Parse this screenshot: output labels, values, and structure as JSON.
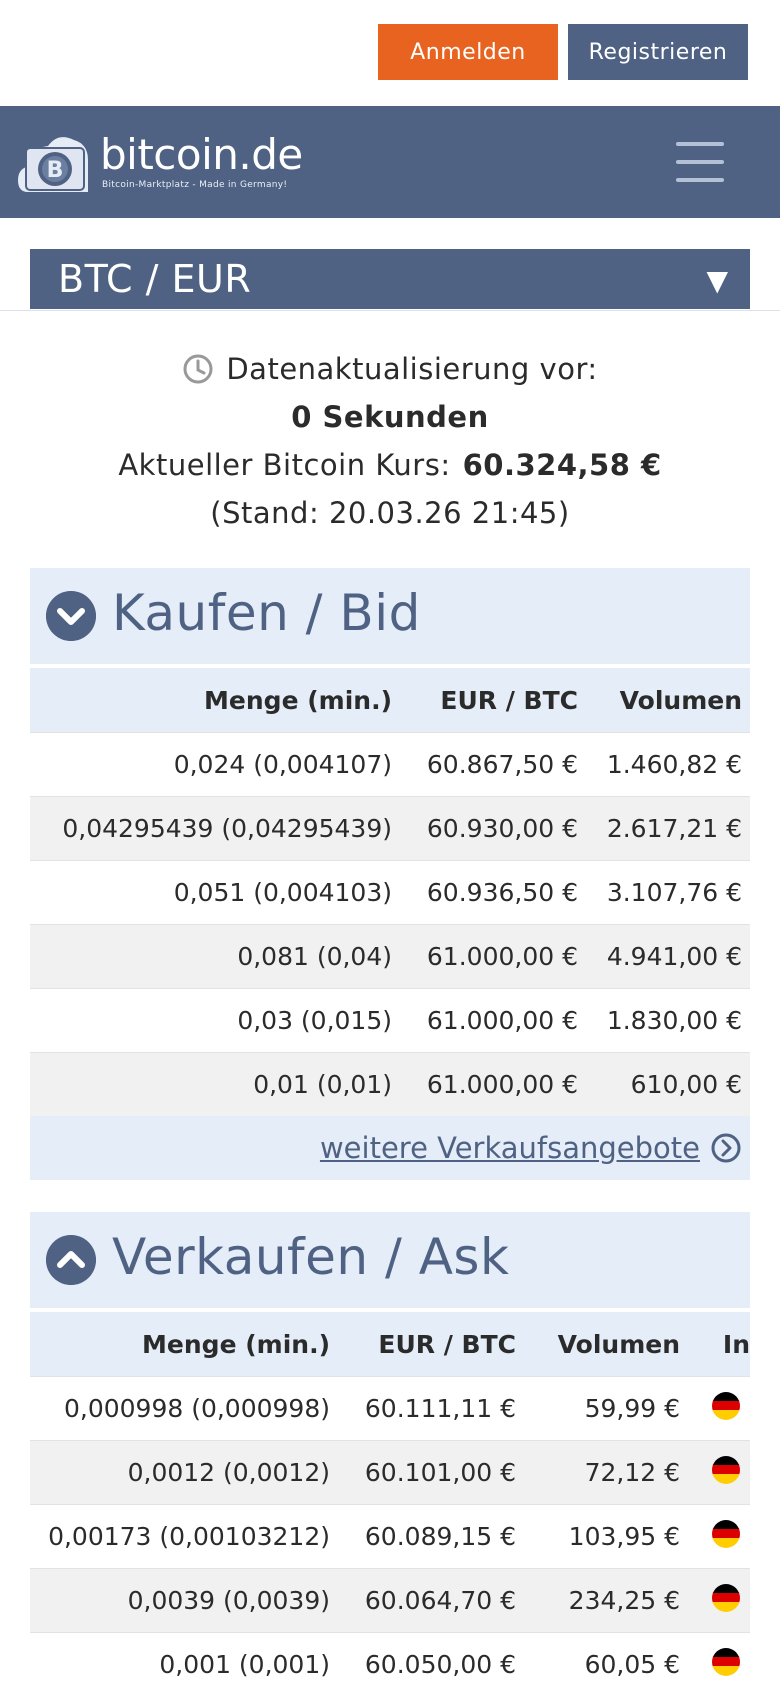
{
  "top": {
    "login_label": "Anmelden",
    "register_label": "Registrieren"
  },
  "brand": {
    "name": "bitcoin.de",
    "tagline": "Bitcoin-Marktplatz - Made in Germany!"
  },
  "pair": {
    "label": "BTC / EUR",
    "arrow": "▼"
  },
  "info": {
    "update_label": "Datenaktualisierung vor:",
    "update_value": "0 Sekunden",
    "price_label": "Aktueller Bitcoin Kurs:",
    "price_value": "60.324,58 €",
    "stand": "(Stand: 20.03.26 21:45)"
  },
  "bid": {
    "title": "Kaufen / Bid",
    "columns": [
      "Menge (min.)",
      "EUR / BTC",
      "Volumen"
    ],
    "rows": [
      [
        "0,024 (0,004107)",
        "60.867,50 €",
        "1.460,82 €"
      ],
      [
        "0,04295439 (0,04295439)",
        "60.930,00 €",
        "2.617,21 €"
      ],
      [
        "0,051 (0,004103)",
        "60.936,50 €",
        "3.107,76 €"
      ],
      [
        "0,081 (0,04)",
        "61.000,00 €",
        "4.941,00 €"
      ],
      [
        "0,03 (0,015)",
        "61.000,00 €",
        "1.830,00 €"
      ],
      [
        "0,01 (0,01)",
        "61.000,00 €",
        "610,00 €"
      ]
    ],
    "more_label": "weitere Verkaufsangebote"
  },
  "ask": {
    "title": "Verkaufen / Ask",
    "columns": [
      "Menge (min.)",
      "EUR / BTC",
      "Volumen",
      "In"
    ],
    "rows": [
      [
        "0,000998 (0,000998)",
        "60.111,11 €",
        "59,99 €"
      ],
      [
        "0,0012 (0,0012)",
        "60.101,00 €",
        "72,12 €"
      ],
      [
        "0,00173 (0,00103212)",
        "60.089,15 €",
        "103,95 €"
      ],
      [
        "0,0039 (0,0039)",
        "60.064,70 €",
        "234,25 €"
      ],
      [
        "0,001 (0,001)",
        "60.050,00 €",
        "60,05 €"
      ]
    ]
  },
  "colors": {
    "orange": "#e8631f",
    "navy": "#4f6283",
    "light_blue": "#e4edf8"
  },
  "icons": {
    "clock": "clock-icon",
    "chevron_down": "chevron-down-icon",
    "chevron_up": "chevron-up-icon",
    "flag": "germany-flag-icon"
  }
}
